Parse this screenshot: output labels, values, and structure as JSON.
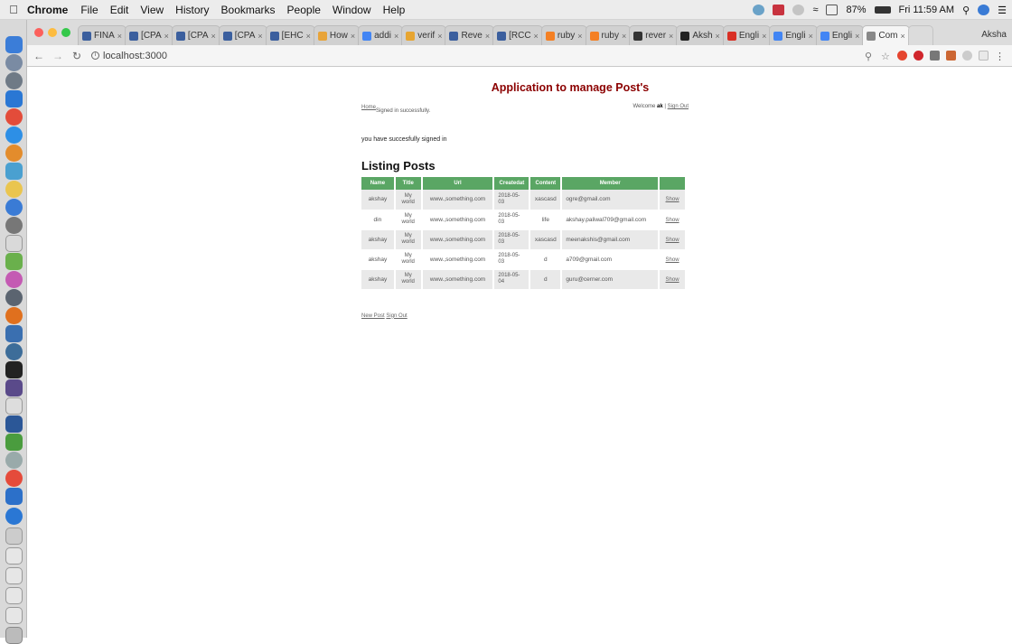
{
  "menubar": {
    "app": "Chrome",
    "items": [
      "File",
      "Edit",
      "View",
      "History",
      "Bookmarks",
      "People",
      "Window",
      "Help"
    ],
    "battery": "87%",
    "clock": "Fri 11:59 AM"
  },
  "tabs": [
    {
      "label": "FINA",
      "color": "#3b5f9e"
    },
    {
      "label": "[CPA",
      "color": "#3b5f9e"
    },
    {
      "label": "[CPA",
      "color": "#3b5f9e"
    },
    {
      "label": "[CPA",
      "color": "#3b5f9e"
    },
    {
      "label": "[EHC",
      "color": "#3b5f9e"
    },
    {
      "label": "How",
      "color": "#e8a43a"
    },
    {
      "label": "addi",
      "color": "#4285f4"
    },
    {
      "label": "verif",
      "color": "#e7a531"
    },
    {
      "label": "Reve",
      "color": "#3b5f9e"
    },
    {
      "label": "[RCC",
      "color": "#3b5f9e"
    },
    {
      "label": "ruby",
      "color": "#f48024"
    },
    {
      "label": "ruby",
      "color": "#f48024"
    },
    {
      "label": "rever",
      "color": "#333333"
    },
    {
      "label": "Aksh",
      "color": "#222222"
    },
    {
      "label": "Engli",
      "color": "#d93025"
    },
    {
      "label": "Engli",
      "color": "#4285f4"
    },
    {
      "label": "Engli",
      "color": "#4285f4"
    },
    {
      "label": "Com",
      "color": "#888888"
    }
  ],
  "profile": "Aksha",
  "url": "localhost:3000",
  "page": {
    "title": "Application to manage Post's",
    "home_link": "Home",
    "flash": "Signed in successfully.",
    "welcome_prefix": "Welcome ",
    "user": "ak",
    "separator": " | ",
    "sign_out": "Sign Out",
    "notice": "you have succesfully signed in",
    "listing_title": "Listing Posts",
    "new_post": "New Post",
    "footer_sign_out": "Sign Out"
  },
  "table": {
    "headers": [
      "Name",
      "Title",
      "Url",
      "Createdat",
      "Content",
      "Member",
      ""
    ],
    "rows": [
      {
        "name": "akshay",
        "title": "My world",
        "url": "www.,something.com",
        "created": "2018-05-03",
        "content": "xascasd",
        "member": "ogre@gmail.com",
        "action": "Show"
      },
      {
        "name": "din",
        "title": "My world",
        "url": "www.,something.com",
        "created": "2018-05-03",
        "content": "life",
        "member": "akshay.paliwal709@gmail.com",
        "action": "Show"
      },
      {
        "name": "akshay",
        "title": "My world",
        "url": "www.,something.com",
        "created": "2018-05-03",
        "content": "xascasd",
        "member": "meenakshis@gmail.com",
        "action": "Show"
      },
      {
        "name": "akshay",
        "title": "My world",
        "url": "www.,something.com",
        "created": "2018-05-03",
        "content": "d",
        "member": "a709@gmail.com",
        "action": "Show"
      },
      {
        "name": "akshay",
        "title": "My world",
        "url": "www.,something.com",
        "created": "2018-05-04",
        "content": "d",
        "member": "guru@cerner.com",
        "action": "Show"
      }
    ]
  },
  "colors": {
    "title": "#8b0000",
    "table_header": "#5aa664"
  }
}
